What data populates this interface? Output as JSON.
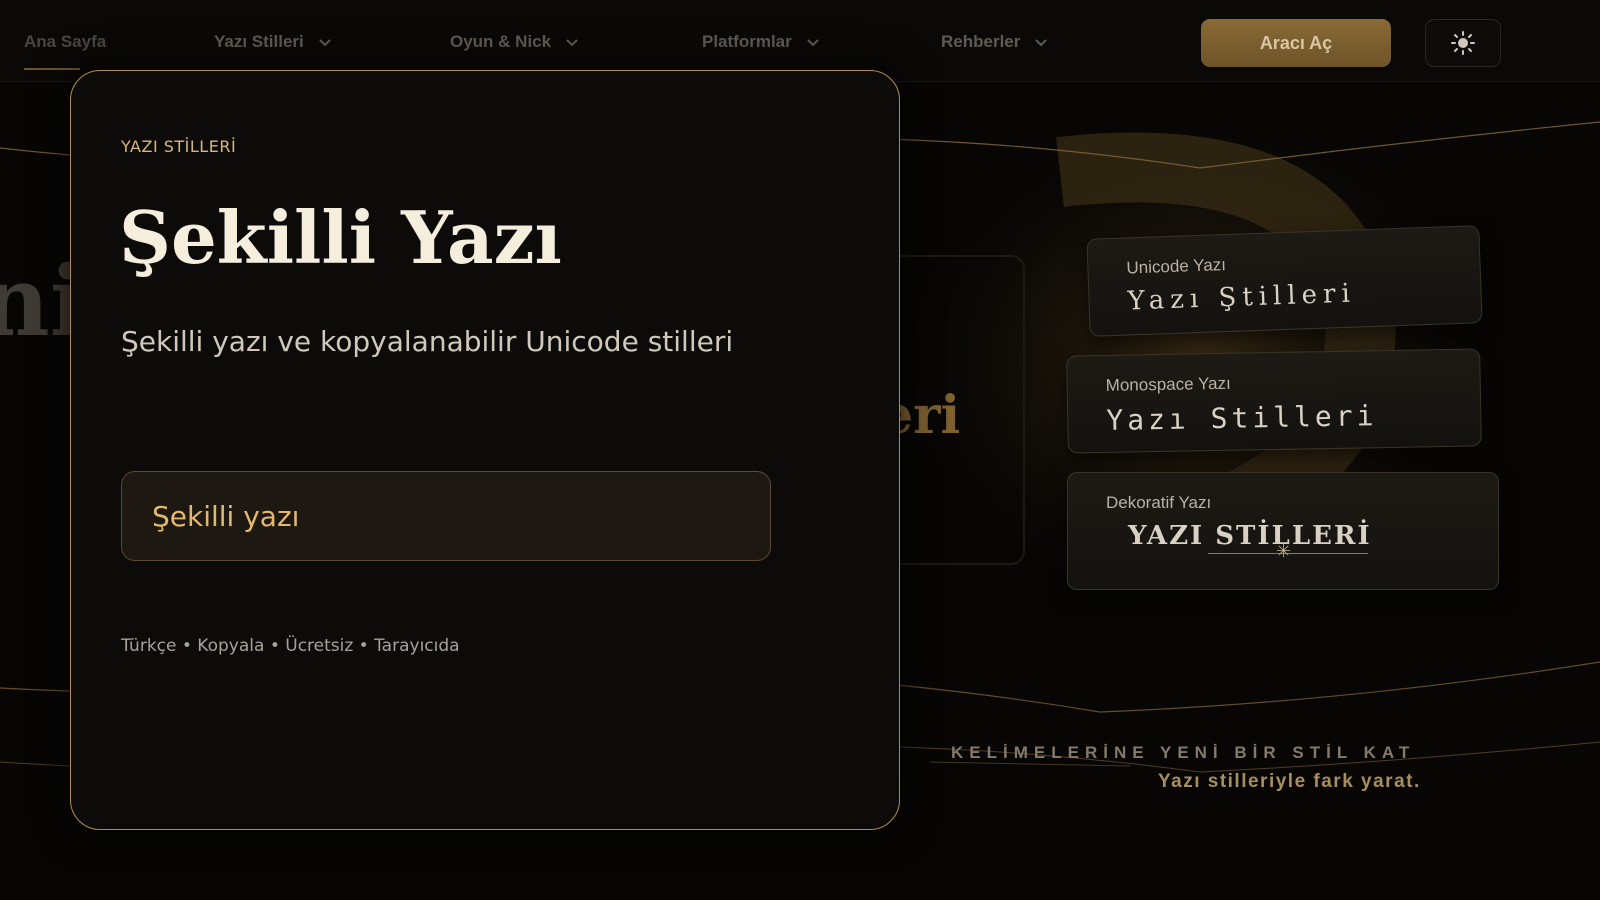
{
  "nav": {
    "items": [
      {
        "label": "Ana Sayfa",
        "dropdown": false
      },
      {
        "label": "Yazı Stilleri",
        "dropdown": true
      },
      {
        "label": "Oyun & Nick",
        "dropdown": true
      },
      {
        "label": "Platformlar",
        "dropdown": true
      },
      {
        "label": "Rehberler",
        "dropdown": true
      }
    ],
    "cta_label": "Aracı Aç",
    "theme_icon": "sun-icon"
  },
  "hero": {
    "big_letter": "ni",
    "big_word": "eri",
    "cards": [
      {
        "label": "Unicode Yazı",
        "sample": "Yazı Ştilleri"
      },
      {
        "label": "Monospace Yazı",
        "sample": "Yazı Stilleri"
      },
      {
        "label": "Dekoratif Yazı",
        "sample": "YAZI STİLLERİ"
      }
    ],
    "tagline": "KELİMELERİNE YENİ BİR STİL KAT",
    "tagline_sub": "Yazı stilleriyle fark yarat."
  },
  "modal": {
    "eyebrow": "YAZI STİLLERİ",
    "title": "Şekilli Yazı",
    "subtitle": "Şekilli yazı ve kopyalanabilir Unicode stilleri",
    "input_value": "Şekilli yazı",
    "meta": "Türkçe • Kopyala • Ücretsiz • Tarayıcıda"
  },
  "colors": {
    "accent": "#b38a4c",
    "gold_text": "#e2b86f",
    "background": "#070605"
  }
}
